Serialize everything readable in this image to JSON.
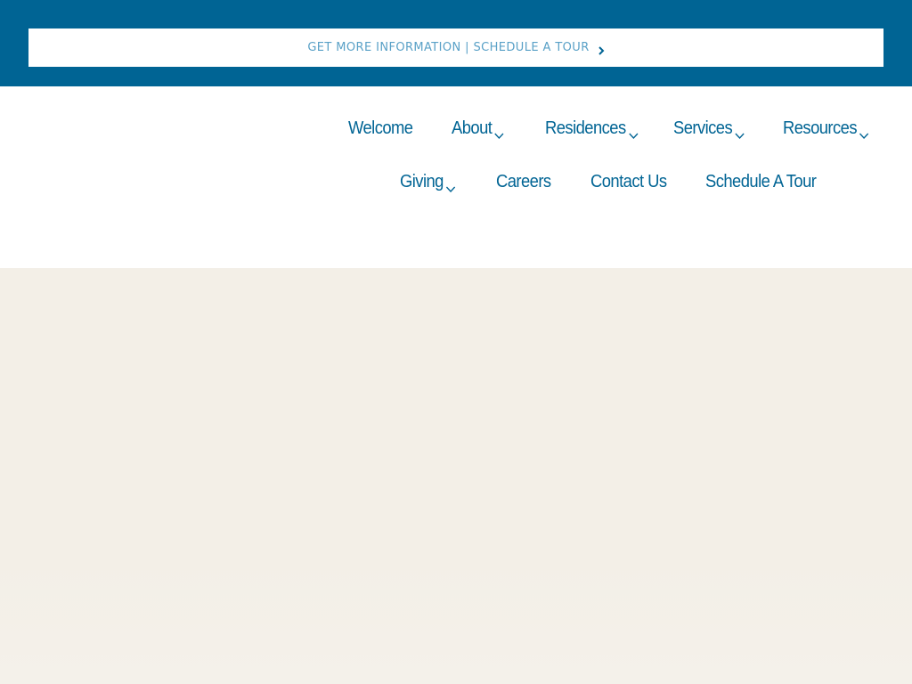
{
  "banner": {
    "text": "GET MORE INFORMATION | SCHEDULE A TOUR",
    "icon": "chevron-right-icon"
  },
  "nav": {
    "welcome": "Welcome",
    "about": "About",
    "residences": "Residences",
    "services": "Services",
    "resources": "Resources",
    "giving": "Giving",
    "careers": "Careers",
    "contact": "Contact Us",
    "tour": "Schedule A Tour"
  },
  "colors": {
    "brand": "#006494",
    "banner_text": "#5aa1c7",
    "hero_bg": "#f3efe7"
  }
}
